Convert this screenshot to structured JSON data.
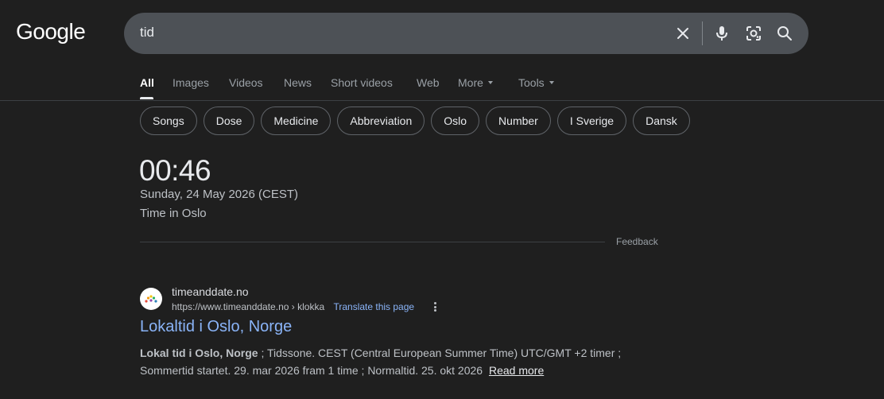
{
  "header": {
    "logo": "Google",
    "search": {
      "value": "tid"
    }
  },
  "tabs": [
    {
      "label": "All",
      "active": true
    },
    {
      "label": "Images"
    },
    {
      "label": "Videos"
    },
    {
      "label": "News"
    },
    {
      "label": "Short videos"
    },
    {
      "label": "Web"
    },
    {
      "label": "More"
    },
    {
      "label": "Tools"
    }
  ],
  "chips": [
    "Songs",
    "Dose",
    "Medicine",
    "Abbreviation",
    "Oslo",
    "Number",
    "I Sverige",
    "Dansk"
  ],
  "time_widget": {
    "time": "00:46",
    "date": "Sunday, 24 May 2026 (CEST)",
    "place": "Time in Oslo",
    "feedback": "Feedback"
  },
  "result": {
    "site_name": "timeanddate.no",
    "url": "https://www.timeanddate.no",
    "url_path": "klokka",
    "translate": "Translate this page",
    "title": "Lokaltid i Oslo, Norge",
    "snippet_bold": "Lokal tid i Oslo, Norge",
    "snippet_rest_1": "; Tidssone. CEST (Central European Summer Time) UTC/GMT +2 timer ;",
    "snippet_rest_2": "Sommertid startet. 29. mar 2026 fram 1 time ; Normaltid. 25. okt 2026",
    "read_more": "Read more"
  },
  "colors": {
    "background": "#1f1f1f",
    "link": "#8ab4f8",
    "search_box": "#4d5156"
  }
}
